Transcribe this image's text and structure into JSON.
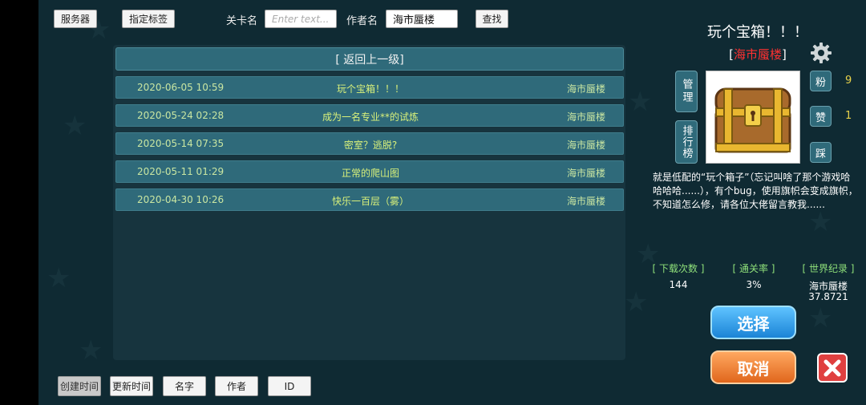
{
  "toolbar": {
    "server_label": "服务器",
    "tag_label": "指定标签",
    "level_name_label": "关卡名",
    "level_name_placeholder": "Enter text...",
    "author_name_label": "作者名",
    "author_name_value": "海市蜃楼",
    "search_label": "查找"
  },
  "list": {
    "back_label": "[ 返回上一级]",
    "rows": [
      {
        "date": "2020-06-05 10:59",
        "name": "玩个宝箱！！！",
        "author": "海市蜃楼"
      },
      {
        "date": "2020-05-24 02:28",
        "name": "成为一名专业**的试炼",
        "author": "海市蜃楼"
      },
      {
        "date": "2020-05-14 07:35",
        "name": "密室？逃脱?",
        "author": "海市蜃楼"
      },
      {
        "date": "2020-05-11 01:29",
        "name": "正常的爬山图",
        "author": "海市蜃楼"
      },
      {
        "date": "2020-04-30 10:26",
        "name": "快乐一百层（雾）",
        "author": "海市蜃楼"
      }
    ]
  },
  "sort": {
    "created_label": "创建时间",
    "updated_label": "更新时间",
    "name_label": "名字",
    "author_label": "作者",
    "id_label": "ID"
  },
  "detail": {
    "title": "玩个宝箱！！！",
    "author_open": "[",
    "author": "海市蜃楼",
    "author_close": "]",
    "manage_label": "管理",
    "ranking_label": "排行榜",
    "fans_label": "粉",
    "fans_count": "9",
    "like_label": "赞",
    "like_count": "1",
    "dislike_label": "踩",
    "description": "就是低配的“玩个箱子”（忘记叫啥了那个游戏哈哈哈哈......），有个bug，使用旗帜会变成旗帜，不知道怎么修，请各位大佬留言教我......",
    "stats": {
      "downloads_label": "[ 下载次数 ]",
      "downloads_value": "144",
      "clear_rate_label": "[ 通关率 ]",
      "clear_rate_value": "3%",
      "record_label": "[ 世界纪录 ]",
      "record_holder": "海市蜃楼",
      "record_value": "37.8721"
    },
    "select_label": "选择",
    "cancel_label": "取消"
  },
  "colors": {
    "background": "#0f2a33",
    "row": "#2f6a7a",
    "row_text": "#d8f07a",
    "author_red": "#ff3030",
    "stat_green": "#8fe07a",
    "count_yellow": "#e8d24a"
  }
}
